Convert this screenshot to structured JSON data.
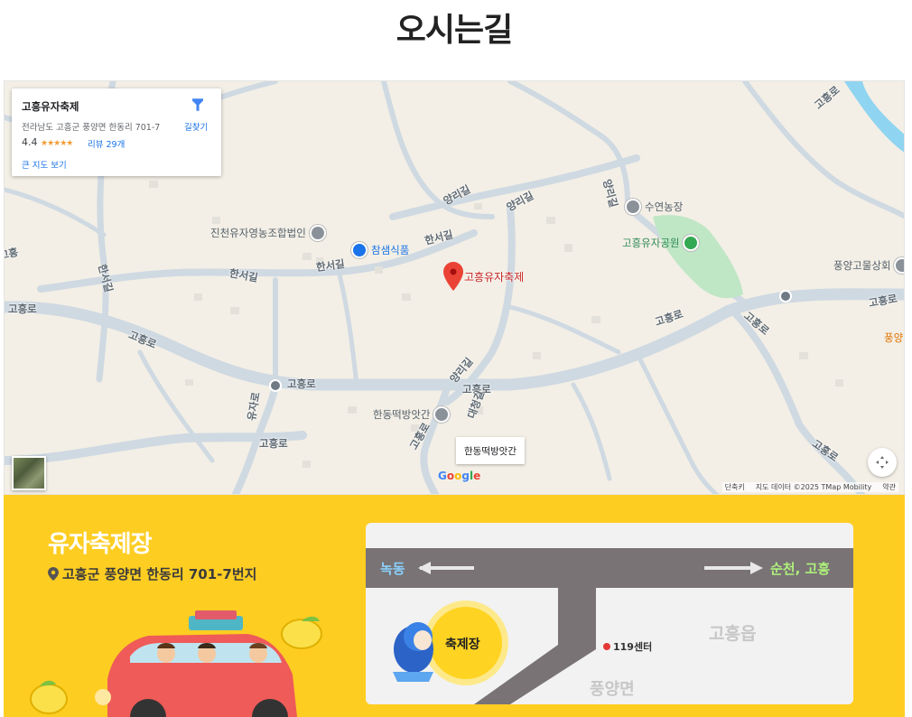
{
  "page": {
    "title": "오시는길"
  },
  "map": {
    "info_card": {
      "name": "고흥유자축제",
      "address": "전라남도 고흥군 풍양면 한동리 701-7",
      "rating": "4.4",
      "stars": "★★★★★",
      "reviews": "리뷰 29개",
      "larger_map": "큰 지도 보기",
      "directions": "길찾기"
    },
    "marker_label": "고흥유자축제",
    "tooltip": "한동떡방앗간",
    "road_labels": {
      "goheung_left": "고흥로",
      "goheung_1": "고흥로",
      "goheung_2": "고흥로",
      "goheung_3": "고흥로",
      "goheung_4": "고흥로",
      "goheung_5": "고흥로",
      "goheung_6": "고흥로",
      "goheung_7": "고흥로",
      "goheung_8": "고흥로",
      "goheung_right": "고흥로",
      "hanseo_1": "한서길",
      "hanseo_2": "한서길",
      "hanseo_3": "한서길",
      "hanseo_4": "한서길",
      "yangri_1": "양리길",
      "yangri_2": "양리길",
      "yangri_3": "양리길",
      "yangri_4": "양리길",
      "yujaro": "유자로",
      "daecheong": "대청길",
      "edge_left": "고흥"
    },
    "pois": {
      "jincheon": "진천유자영농조합법인",
      "chamsaem": "참샘식품",
      "suyeon": "수연농장",
      "yuja_park": "고흥유자공원",
      "pungyang_store": "풍양고물상회",
      "pungyang_edge": "풍양",
      "handong": "한동떡방앗간"
    },
    "google": [
      "G",
      "o",
      "o",
      "g",
      "l",
      "e"
    ],
    "attribution": {
      "shortcuts": "단축키",
      "map_data": "지도 데이터 ©2025 TMap Mobility",
      "terms": "약관"
    }
  },
  "banner": {
    "venue_title": "유자축제장",
    "venue_address": "고흥군 풍양면 한동리 701-7번지",
    "route": {
      "left_dest": "녹동",
      "right_dest": "순천, 고흥",
      "festival": "축제장",
      "center_119": "119센터",
      "goheung_eup": "고흥읍",
      "pungyang_myeon": "풍양면"
    }
  },
  "colors": {
    "banner_bg": "#fecd22",
    "road_gray": "#797375",
    "festival_circle": "#fed322",
    "marker_red": "#ea4335",
    "dest_blue": "#8ad2ff",
    "dest_green": "#aef07c"
  }
}
